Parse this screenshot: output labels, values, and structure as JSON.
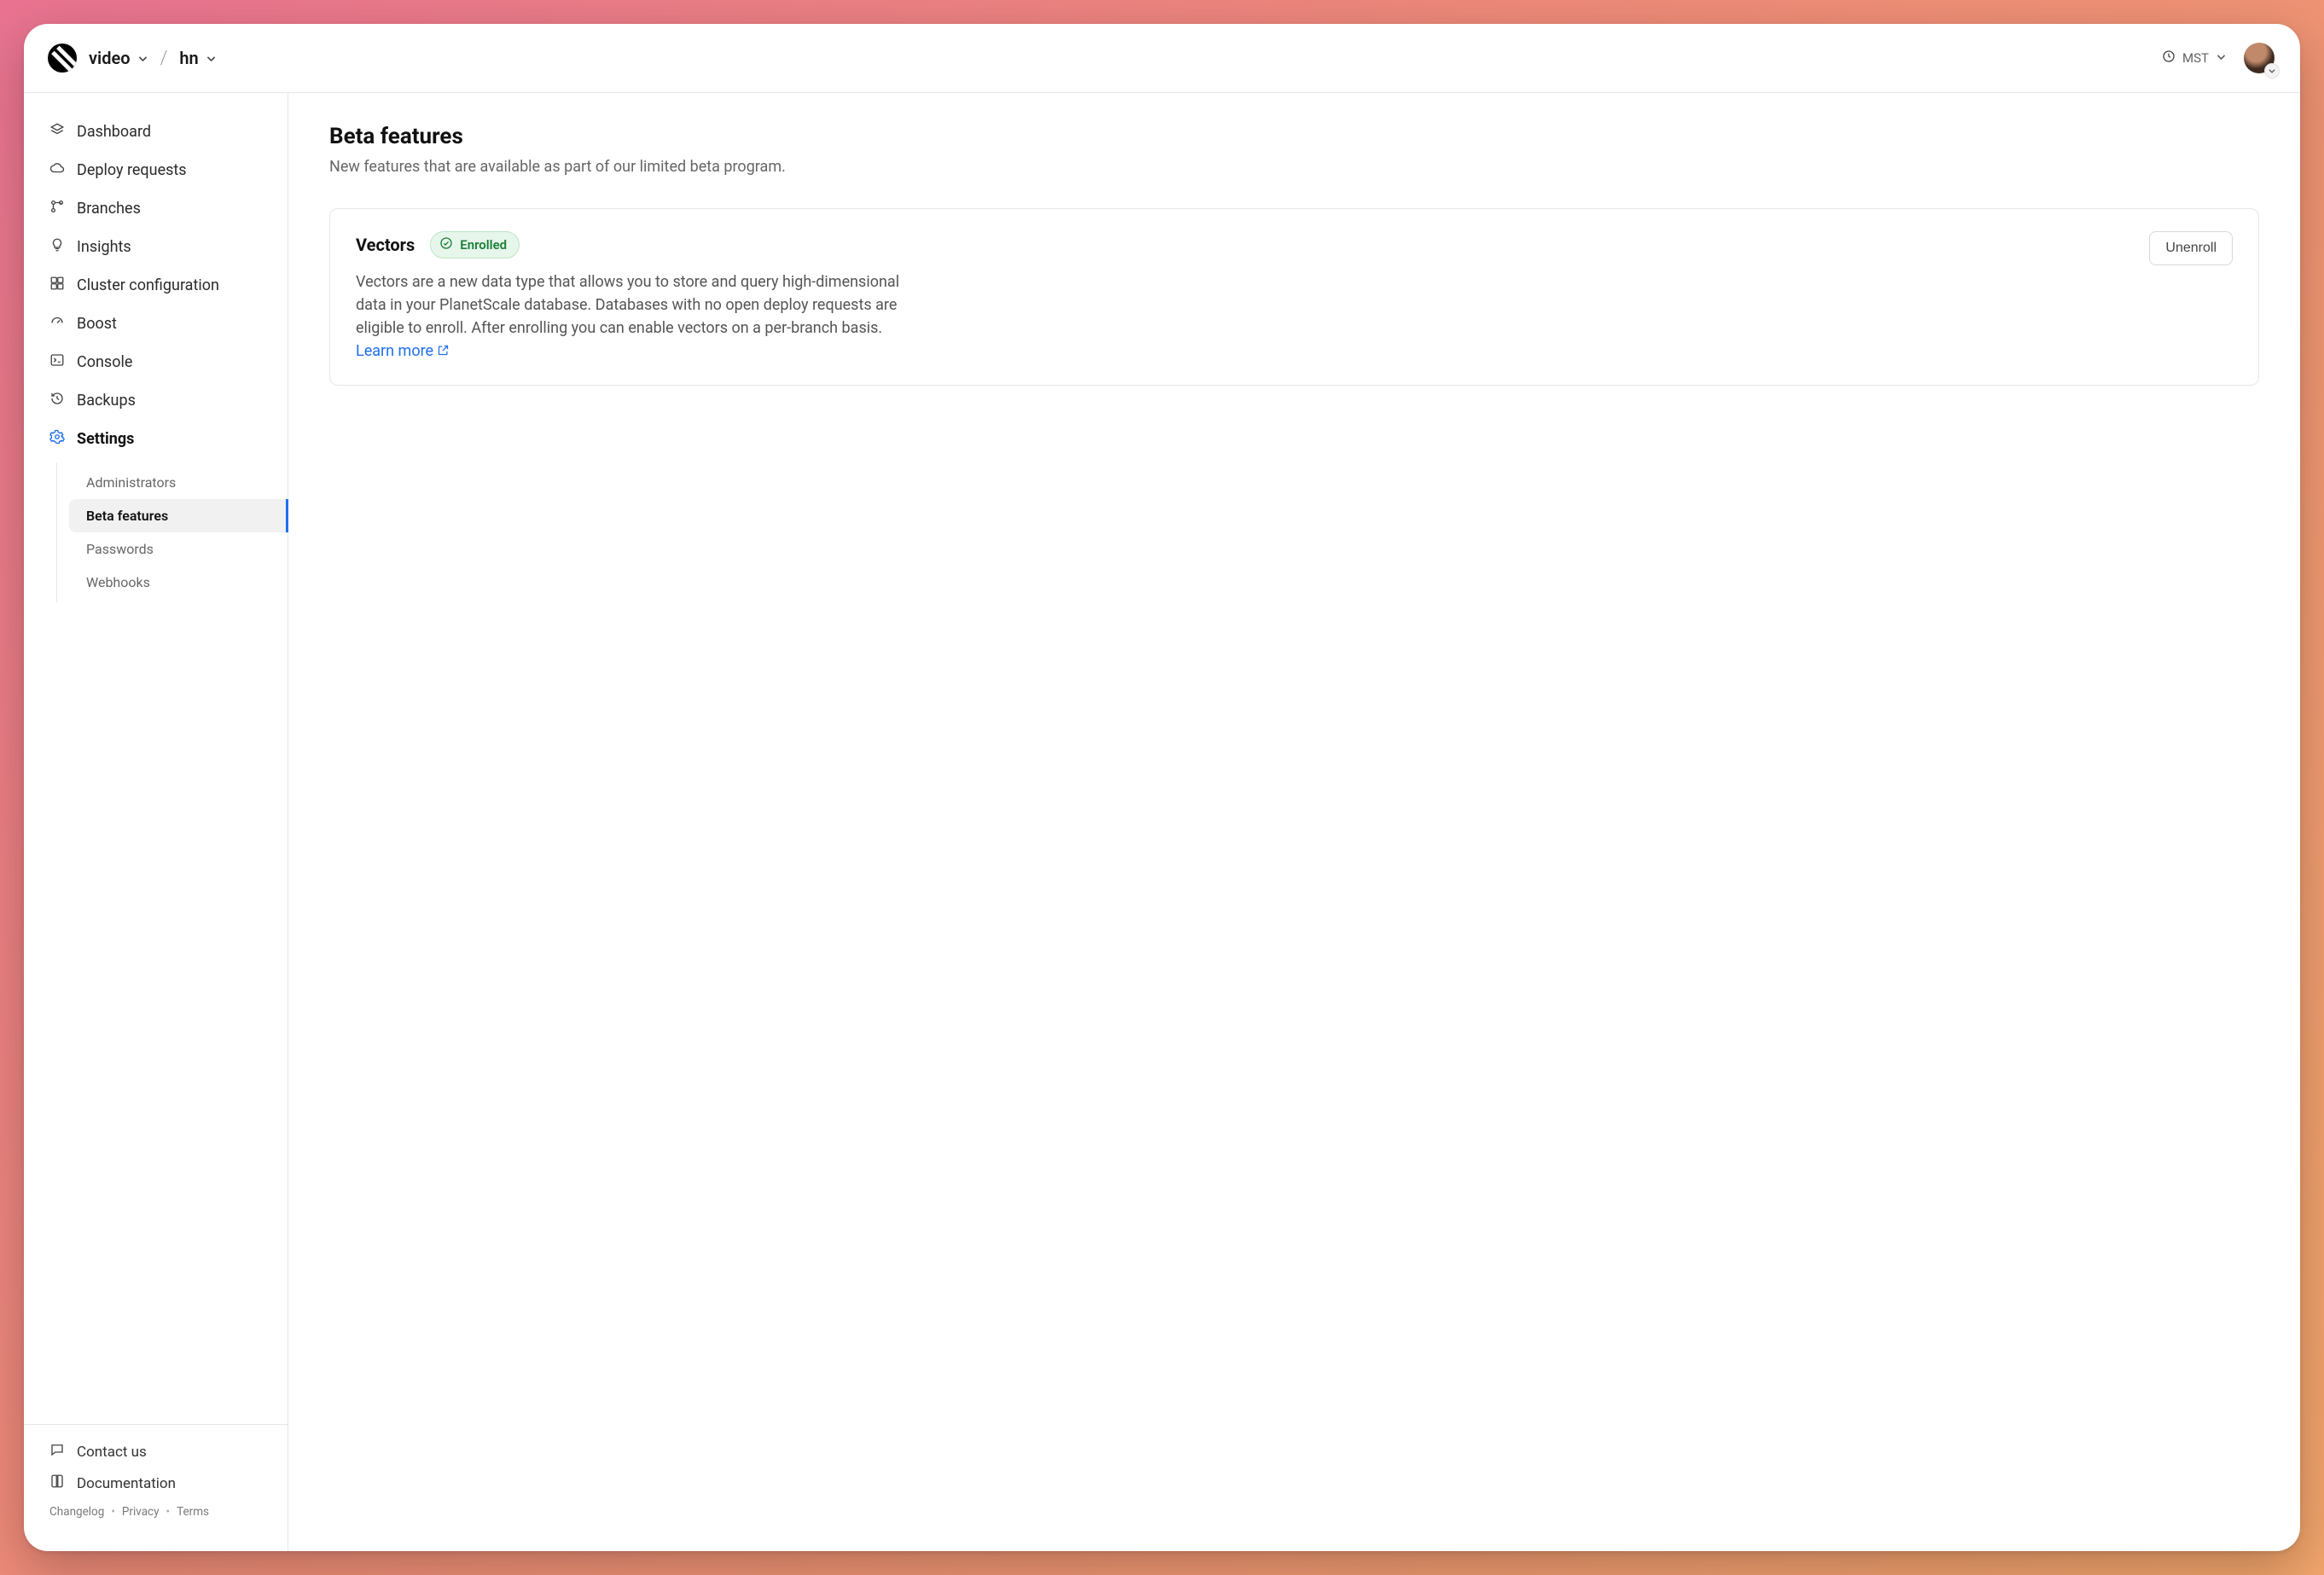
{
  "header": {
    "org": "video",
    "db": "hn",
    "timezone": "MST"
  },
  "sidebar": {
    "items": [
      {
        "id": "dashboard",
        "label": "Dashboard"
      },
      {
        "id": "deploy-requests",
        "label": "Deploy requests"
      },
      {
        "id": "branches",
        "label": "Branches"
      },
      {
        "id": "insights",
        "label": "Insights"
      },
      {
        "id": "cluster-config",
        "label": "Cluster configuration"
      },
      {
        "id": "boost",
        "label": "Boost"
      },
      {
        "id": "console",
        "label": "Console"
      },
      {
        "id": "backups",
        "label": "Backups"
      },
      {
        "id": "settings",
        "label": "Settings"
      }
    ],
    "settings_sub": [
      {
        "id": "administrators",
        "label": "Administrators"
      },
      {
        "id": "beta-features",
        "label": "Beta features"
      },
      {
        "id": "passwords",
        "label": "Passwords"
      },
      {
        "id": "webhooks",
        "label": "Webhooks"
      }
    ],
    "bottom": {
      "contact": "Contact us",
      "docs": "Documentation"
    },
    "legal": {
      "changelog": "Changelog",
      "privacy": "Privacy",
      "terms": "Terms"
    }
  },
  "page": {
    "title": "Beta features",
    "subtitle": "New features that are available as part of our limited beta program."
  },
  "feature": {
    "title": "Vectors",
    "status": "Enrolled",
    "description": "Vectors are a new data type that allows you to store and query high-dimensional data in your PlanetScale database. Databases with no open deploy requests are eligible to enroll. After enrolling you can enable vectors on a per-branch basis. ",
    "learn_more": "Learn more",
    "unenroll": "Unenroll"
  }
}
